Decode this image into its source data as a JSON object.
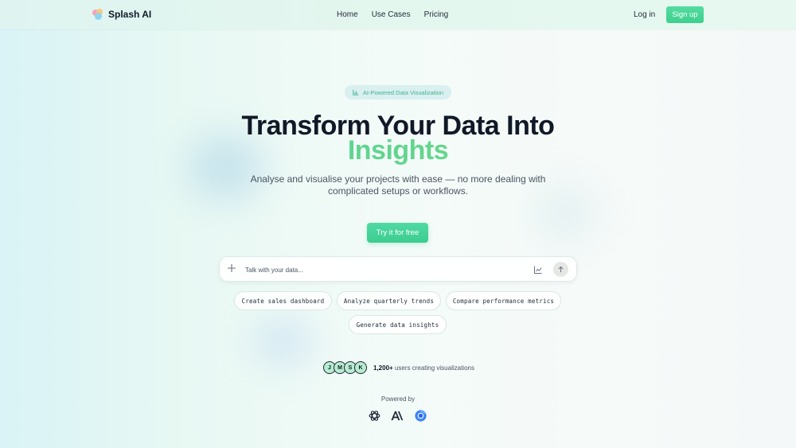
{
  "header": {
    "logo_text": "Splash AI",
    "nav": [
      "Home",
      "Use Cases",
      "Pricing"
    ],
    "login_label": "Log in",
    "signup_label": "Sign up"
  },
  "hero": {
    "badge": "AI-Powered Data Visualization",
    "title_line1": "Transform Your Data Into",
    "title_line2": "Insights",
    "subtitle_line1": "Analyse and visualise your projects with ease — no more dealing with",
    "subtitle_line2": "complicated setups or workflows.",
    "cta_label": "Try it for free"
  },
  "chat": {
    "placeholder": "Talk with your data...",
    "value": ""
  },
  "suggestions": [
    "Create sales dashboard",
    "Analyze quarterly trends",
    "Compare performance metrics",
    "Generate data insights"
  ],
  "social_proof": {
    "avatars": [
      "J",
      "M",
      "S",
      "K"
    ],
    "count": "1,200+",
    "text": "users creating visualizations"
  },
  "powered_by": {
    "label": "Powered by",
    "brands": [
      "openai-icon",
      "anthropic-icon",
      "chrome-like-icon"
    ]
  },
  "colors": {
    "accent": "#3fcf8e",
    "accent_text": "#5fd69a"
  }
}
